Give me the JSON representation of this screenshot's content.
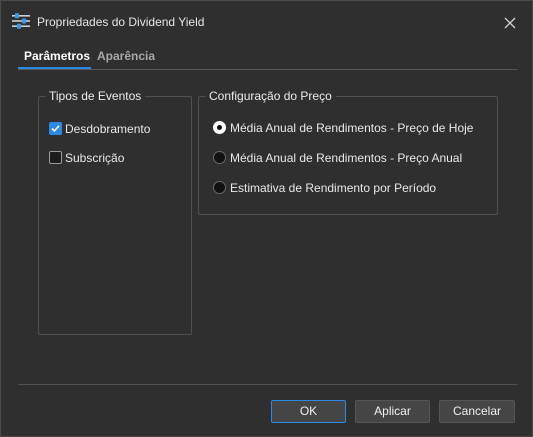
{
  "window": {
    "title": "Propriedades do Dividend Yield",
    "icon": "sliders-icon",
    "close_icon": "close-icon"
  },
  "tabs": [
    {
      "label": "Parâmetros",
      "active": true
    },
    {
      "label": "Aparência",
      "active": false
    }
  ],
  "events_group": {
    "title": "Tipos de Eventos",
    "items": [
      {
        "label": "Desdobramento",
        "checked": true
      },
      {
        "label": "Subscrição",
        "checked": false
      }
    ]
  },
  "price_group": {
    "title": "Configuração do Preço",
    "options": [
      {
        "label": "Média Anual de Rendimentos - Preço de Hoje",
        "selected": true
      },
      {
        "label": "Média Anual de Rendimentos - Preço Anual",
        "selected": false
      },
      {
        "label": "Estimativa de Rendimento por Período",
        "selected": false
      }
    ]
  },
  "buttons": {
    "ok": "OK",
    "apply": "Aplicar",
    "cancel": "Cancelar"
  },
  "colors": {
    "background": "#2f2f2f",
    "accent": "#2b8ae3",
    "text": "#e8e8e8"
  }
}
